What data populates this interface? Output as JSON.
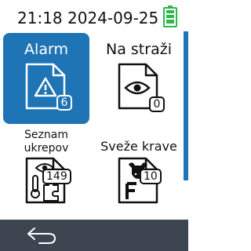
{
  "status": {
    "time": "21:18",
    "date": "2024-09-25",
    "battery_icon": "battery-full-icon",
    "battery_color": "#2db84a"
  },
  "tiles": [
    {
      "label": "Alarm",
      "count": "6",
      "icon": "warning-document-icon",
      "selected": true
    },
    {
      "label": "Na straži",
      "count": "0",
      "icon": "eye-document-icon",
      "selected": false
    },
    {
      "label_lines": [
        "Seznam",
        "ukrepov"
      ],
      "count": "149",
      "icon": "eye-thermometer-puzzle-document-icon",
      "selected": false
    },
    {
      "label": "Sveže krave",
      "count": "10",
      "icon": "cow-f-document-icon",
      "selected": false
    }
  ],
  "footer": {
    "back_icon": "back-arrow-icon"
  },
  "colors": {
    "accent": "#1f74b5",
    "footer_bg": "#3d4650",
    "background": "#ffffff"
  }
}
